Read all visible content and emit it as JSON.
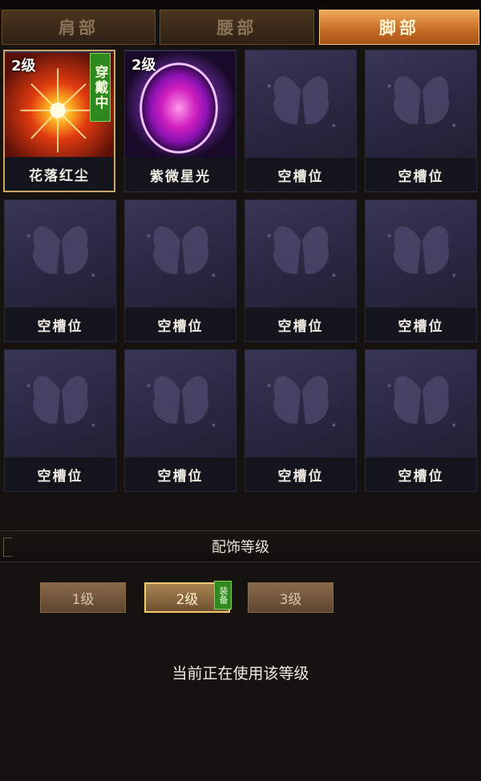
{
  "tabs": [
    {
      "label": "肩部"
    },
    {
      "label": "腰部"
    },
    {
      "label": "脚部",
      "active": true
    }
  ],
  "slots": [
    {
      "label": "花落红尘",
      "level": "2级",
      "equipped_tag": "穿戴中",
      "icon": "red-starburst"
    },
    {
      "label": "紫微星光",
      "level": "2级",
      "icon": "purple-orb"
    },
    {
      "label": "空槽位",
      "icon": "butterfly-placeholder"
    },
    {
      "label": "空槽位",
      "icon": "butterfly-placeholder"
    },
    {
      "label": "空槽位",
      "icon": "butterfly-placeholder"
    },
    {
      "label": "空槽位",
      "icon": "butterfly-placeholder"
    },
    {
      "label": "空槽位",
      "icon": "butterfly-placeholder"
    },
    {
      "label": "空槽位",
      "icon": "butterfly-placeholder"
    },
    {
      "label": "空槽位",
      "icon": "butterfly-placeholder"
    },
    {
      "label": "空槽位",
      "icon": "butterfly-placeholder"
    },
    {
      "label": "空槽位",
      "icon": "butterfly-placeholder"
    },
    {
      "label": "空槽位",
      "icon": "butterfly-placeholder"
    }
  ],
  "level_section": {
    "title": "配饰等级",
    "levels": [
      {
        "label": "1级"
      },
      {
        "label": "2级",
        "selected": true,
        "tag": "装备"
      },
      {
        "label": "3级"
      }
    ],
    "status": "当前正在使用该等级"
  },
  "colors": {
    "active_tab": "#e08a3a",
    "equipped_green": "#2e8a1e",
    "slot_bg": "#2b2944"
  }
}
